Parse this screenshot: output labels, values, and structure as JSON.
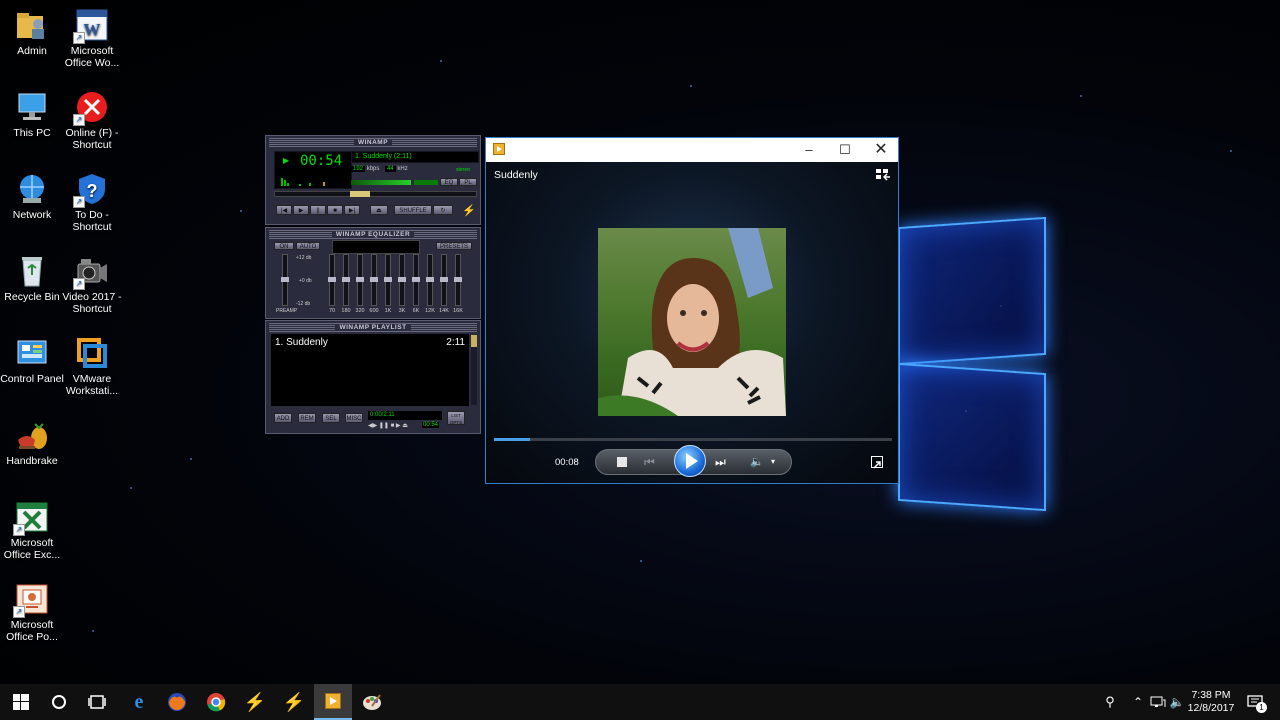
{
  "desktop": {
    "icons": [
      {
        "label": "Admin",
        "icon": "user-folder-icon"
      },
      {
        "label": "Microsoft Office Wo...",
        "icon": "word-icon"
      },
      {
        "label": "This PC",
        "icon": "computer-icon"
      },
      {
        "label": "Online (F) - Shortcut",
        "icon": "error-drive-icon"
      },
      {
        "label": "Network",
        "icon": "network-icon"
      },
      {
        "label": "To Do - Shortcut",
        "icon": "shield-question-icon"
      },
      {
        "label": "Recycle Bin",
        "icon": "recycle-bin-icon"
      },
      {
        "label": "Video 2017 - Shortcut",
        "icon": "camcorder-icon"
      },
      {
        "label": "Control Panel",
        "icon": "control-panel-icon"
      },
      {
        "label": "VMware Workstati...",
        "icon": "vmware-icon"
      },
      {
        "label": "Handbrake",
        "icon": "handbrake-icon"
      },
      {
        "label": "Microsoft Office Exc...",
        "icon": "excel-icon"
      },
      {
        "label": "Microsoft Office Po...",
        "icon": "powerpoint-icon"
      }
    ]
  },
  "winamp": {
    "main_title": "WINAMP",
    "time": "00:54",
    "track": "1. Suddenly (2:11)",
    "kbps_value": "192",
    "kbps_label": "kbps",
    "khz_value": "44",
    "khz_label": "kHz",
    "stereo": "stereo",
    "shuffle": "SHUFFLE",
    "eq_btn": "EQ",
    "pl_btn": "PL",
    "eq_title": "WINAMP EQUALIZER",
    "eq_on": "ON",
    "eq_auto": "AUTO",
    "eq_presets": "PRESETS",
    "eq_db_top": "+12 db",
    "eq_db_mid": "+0 db",
    "eq_db_bot": "-12 db",
    "eq_preamp": "PREAMP",
    "eq_bands": [
      "70",
      "180",
      "320",
      "600",
      "1K",
      "3K",
      "6K",
      "12K",
      "14K",
      "16K"
    ],
    "pl_title": "WINAMP PLAYLIST",
    "playlist": [
      {
        "title": "1. Suddenly",
        "length": "2:11"
      }
    ],
    "pl_add": "ADD",
    "pl_rem": "REM",
    "pl_sel": "SEL",
    "pl_misc": "MISC",
    "pl_time": "0:00/2:11",
    "pl_elapsed": "00:54",
    "pl_list": "LIST OPTS"
  },
  "media_player": {
    "now_playing": "Suddenly",
    "elapsed": "00:08",
    "progress_fraction": 0.09
  },
  "taskbar": {
    "time": "7:38 PM",
    "date": "12/8/2017",
    "notification_count": "1"
  },
  "colors": {
    "accent": "#2f7fcf",
    "winamp_green": "#00e000",
    "taskbar_bg": "#101010"
  }
}
